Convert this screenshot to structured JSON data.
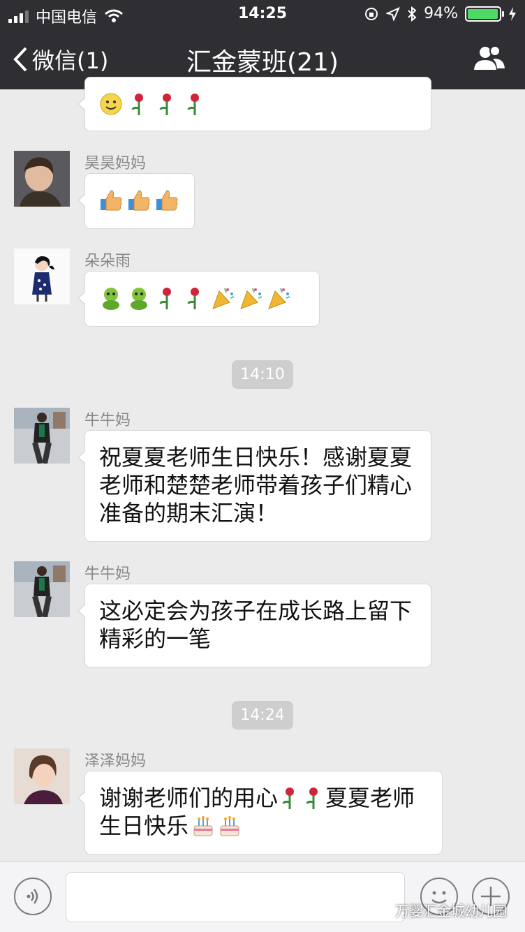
{
  "status": {
    "carrier": "中国电信",
    "time": "14:25",
    "battery": "94%"
  },
  "nav": {
    "back_label": "微信(1)",
    "title": "汇金蒙班(21)"
  },
  "messages": [
    {
      "sender": "昊昊妈妈",
      "emoji": [
        "thumbs-up",
        "thumbs-up",
        "thumbs-up"
      ]
    },
    {
      "sender": "朵朵雨",
      "emoji": [
        "green-face",
        "green-face",
        "rose",
        "rose",
        "party-popper",
        "party-popper",
        "party-popper"
      ]
    },
    {
      "timestamp": "14:10"
    },
    {
      "sender": "牛牛妈",
      "lines": [
        "祝夏夏老师生日快乐！感谢夏夏",
        "老师和楚楚老师带着孩子们精心",
        "准备的期末汇演！"
      ]
    },
    {
      "sender": "牛牛妈",
      "lines": [
        "这必定会为孩子在成长路上留下",
        "精彩的一笔"
      ]
    },
    {
      "timestamp": "14:24"
    },
    {
      "sender": "泽泽妈妈",
      "line1": "谢谢老师们的用心",
      "line1b": "夏夏老师",
      "line2": "生日快乐"
    }
  ],
  "watermark": "万婴汇金城幼儿园",
  "colors": {
    "nav_bg": "#2e2e33",
    "chat_bg": "#ebebeb",
    "battery": "#4cd964"
  }
}
